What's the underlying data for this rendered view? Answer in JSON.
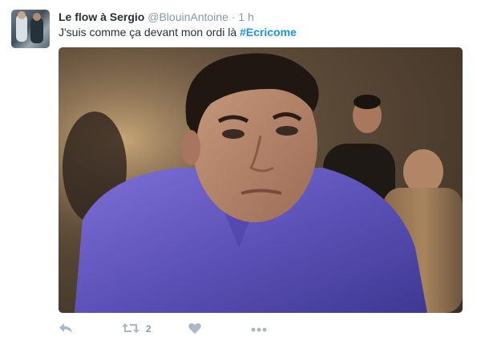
{
  "tweet": {
    "display_name": "Le flow à Sergio",
    "handle": "@BlouinAntoine",
    "separator": "·",
    "time": "1 h",
    "text_prefix": "J'suis comme ça devant mon ordi là ",
    "hashtag": "#Ecricome"
  },
  "actions": {
    "retweet_count": "2"
  },
  "icons": [
    "reply-icon",
    "retweet-icon",
    "like-icon",
    "more-icon"
  ],
  "colors": {
    "link": "#1b95e0",
    "icon": "#aab8c2",
    "muted": "#8899a6"
  }
}
